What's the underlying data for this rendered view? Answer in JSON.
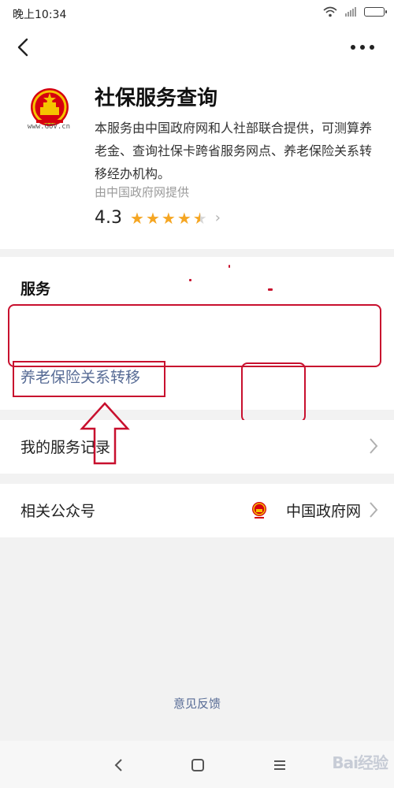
{
  "status_bar": {
    "time": "晚上10:34"
  },
  "nav": {
    "back_icon": "chevron-left-icon",
    "more_icon": "more-dots-icon"
  },
  "app": {
    "title": "社保服务查询",
    "description": "本服务由中国政府网和人社部联合提供，可测算养老金、查询社保卡跨省服务网点、养老保险关系转移经办机构。",
    "provider": "由中国政府网提供",
    "logo_caption": "www.GOV.cn",
    "rating": "4.3",
    "rating_stars": 4.5,
    "star_color": "#f5a623"
  },
  "services": {
    "title": "服务",
    "items": [
      {
        "label": "养老保险关系转移"
      }
    ],
    "link_color": "#576b95",
    "annotation_color": "#c8102e"
  },
  "my_records": {
    "label": "我的服务记录"
  },
  "related_account": {
    "label": "相关公众号",
    "value": "中国政府网"
  },
  "feedback": {
    "label": "意见反馈"
  },
  "system_nav": {
    "icons": [
      "back-triangle-icon",
      "home-square-icon",
      "menu-lines-icon"
    ]
  },
  "watermark": {
    "text": "Bai经验"
  }
}
